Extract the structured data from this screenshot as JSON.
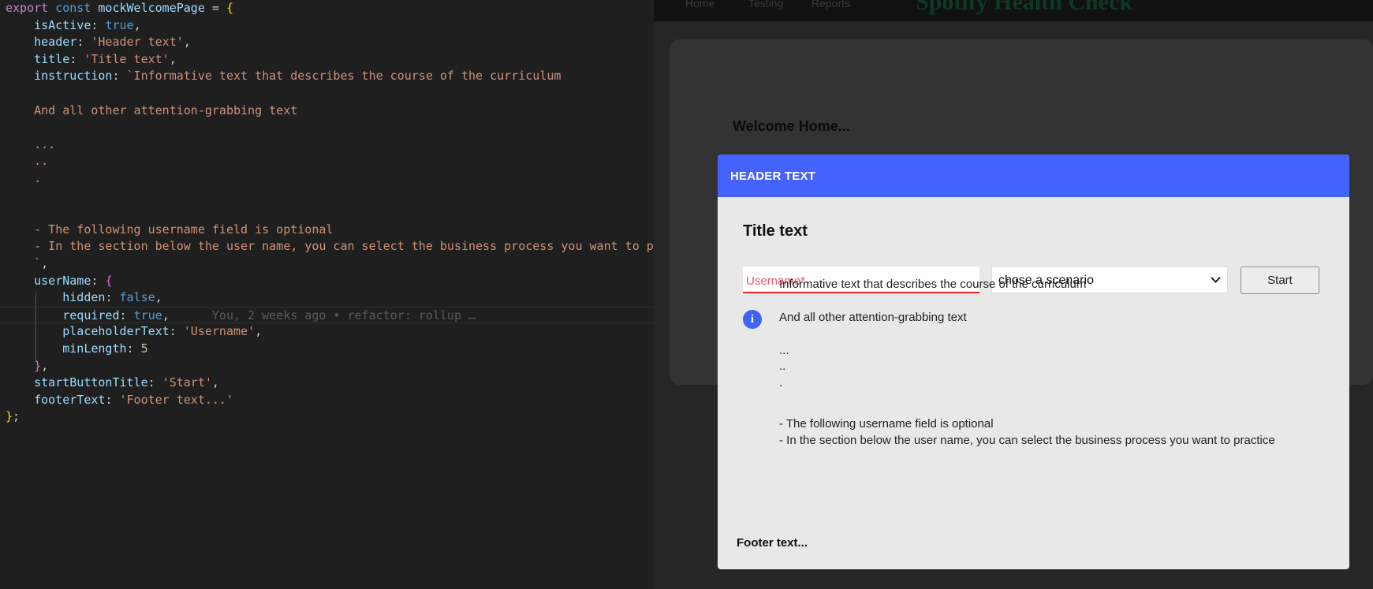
{
  "editor": {
    "code_lines": [
      {
        "parts": [
          [
            "kw",
            "export"
          ],
          [
            "pun",
            " "
          ],
          [
            "kw2",
            "const"
          ],
          [
            "pun",
            " "
          ],
          [
            "id",
            "mockWelcomePage"
          ],
          [
            "pun",
            " = "
          ],
          [
            "br1",
            "{"
          ]
        ]
      },
      {
        "parts": [
          [
            "pun",
            "    "
          ],
          [
            "id",
            "isActive"
          ],
          [
            "pun",
            ": "
          ],
          [
            "kw2",
            "true"
          ],
          [
            "pun",
            ","
          ]
        ]
      },
      {
        "parts": [
          [
            "pun",
            "    "
          ],
          [
            "id",
            "header"
          ],
          [
            "pun",
            ": "
          ],
          [
            "str",
            "'Header text'"
          ],
          [
            "pun",
            ","
          ]
        ]
      },
      {
        "parts": [
          [
            "pun",
            "    "
          ],
          [
            "id",
            "title"
          ],
          [
            "pun",
            ": "
          ],
          [
            "str",
            "'Title text'"
          ],
          [
            "pun",
            ","
          ]
        ]
      },
      {
        "parts": [
          [
            "pun",
            "    "
          ],
          [
            "id",
            "instruction"
          ],
          [
            "pun",
            ": "
          ],
          [
            "str",
            "`Informative text that describes the course of the curriculum"
          ]
        ]
      },
      {
        "parts": []
      },
      {
        "parts": [
          [
            "str",
            "    And all other attention-grabbing text"
          ]
        ]
      },
      {
        "parts": []
      },
      {
        "parts": [
          [
            "str",
            "    ..."
          ]
        ]
      },
      {
        "parts": [
          [
            "str",
            "    .."
          ]
        ]
      },
      {
        "parts": [
          [
            "str",
            "    ."
          ]
        ]
      },
      {
        "parts": []
      },
      {
        "parts": []
      },
      {
        "parts": [
          [
            "str",
            "    - The following username field is optional"
          ]
        ]
      },
      {
        "parts": [
          [
            "str",
            "    - In the section below the user name, you can select the business process you want to practice"
          ]
        ]
      },
      {
        "parts": [
          [
            "str",
            "    `"
          ],
          [
            "pun",
            ","
          ]
        ]
      },
      {
        "parts": [
          [
            "pun",
            "    "
          ],
          [
            "id",
            "userName"
          ],
          [
            "pun",
            ": "
          ],
          [
            "br2",
            "{"
          ]
        ]
      },
      {
        "parts": [
          [
            "pun",
            "        "
          ],
          [
            "id",
            "hidden"
          ],
          [
            "pun",
            ": "
          ],
          [
            "kw2",
            "false"
          ],
          [
            "pun",
            ","
          ]
        ]
      },
      {
        "parts": [
          [
            "pun",
            "        "
          ],
          [
            "id",
            "required"
          ],
          [
            "pun",
            ": "
          ],
          [
            "kw2",
            "true"
          ],
          [
            "pun",
            ","
          ],
          [
            "blame",
            "      You, 2 weeks ago • refactor: rollup …"
          ]
        ],
        "current": true
      },
      {
        "parts": [
          [
            "pun",
            "        "
          ],
          [
            "id",
            "placeholderText"
          ],
          [
            "pun",
            ": "
          ],
          [
            "str",
            "'Username'"
          ],
          [
            "pun",
            ","
          ]
        ]
      },
      {
        "parts": [
          [
            "pun",
            "        "
          ],
          [
            "id",
            "minLength"
          ],
          [
            "pun",
            ": "
          ],
          [
            "num",
            "5"
          ]
        ]
      },
      {
        "parts": [
          [
            "pun",
            "    "
          ],
          [
            "br2",
            "}"
          ],
          [
            "pun",
            ","
          ]
        ]
      },
      {
        "parts": [
          [
            "pun",
            "    "
          ],
          [
            "id",
            "startButtonTitle"
          ],
          [
            "pun",
            ": "
          ],
          [
            "str",
            "'Start'"
          ],
          [
            "pun",
            ","
          ]
        ]
      },
      {
        "parts": [
          [
            "pun",
            "    "
          ],
          [
            "id",
            "footerText"
          ],
          [
            "pun",
            ": "
          ],
          [
            "str",
            "'Footer text...'"
          ]
        ]
      },
      {
        "parts": [
          [
            "br1",
            "}"
          ],
          [
            "pun",
            ";"
          ]
        ]
      }
    ]
  },
  "browser": {
    "nav": {
      "links": [
        "Home",
        "Testing",
        "Reports"
      ],
      "brand": "Spotify Health Check"
    },
    "welcome": "Welcome Home...",
    "modal": {
      "header": "HEADER TEXT",
      "title": "Title text",
      "username_placeholder": "Username*",
      "scenario_selected": "chose a scenario",
      "start_label": "Start",
      "info_icon_glyph": "i",
      "instruction_lines": [
        "Informative text that describes the course of the curriculum",
        "And all other attention-grabbing text",
        "...",
        "..",
        ".",
        "- The following username field is optional",
        "- In the section below the user name, you can select the business process you want to practice"
      ],
      "footer": "Footer text..."
    }
  }
}
